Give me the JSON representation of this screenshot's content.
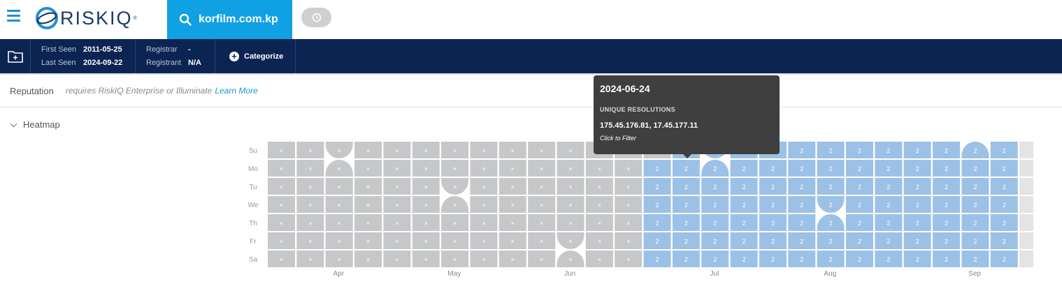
{
  "header": {
    "logo_text": "RISKIQ",
    "logo_reg": "®",
    "search_query": "korfilm.com.kp",
    "icons": [
      "menu-icon",
      "search-icon",
      "history-icon"
    ]
  },
  "infobar": {
    "first_seen_label": "First Seen",
    "first_seen_value": "2011-05-25",
    "last_seen_label": "Last Seen",
    "last_seen_value": "2024-09-22",
    "registrar_label": "Registrar",
    "registrar_value": "-",
    "registrant_label": "Registrant",
    "registrant_value": "N/A",
    "categorize_label": "Categorize"
  },
  "reputation": {
    "title": "Reputation",
    "note": "requires RiskIQ Enterprise or Illuminate",
    "link": "Learn More"
  },
  "heatmap": {
    "title": "Heatmap",
    "day_labels": [
      "Su",
      "Mo",
      "Tu",
      "We",
      "Th",
      "Fr",
      "Sa"
    ],
    "month_labels": [
      {
        "label": "Apr",
        "week": 2.5
      },
      {
        "label": "May",
        "week": 6.5
      },
      {
        "label": "Jun",
        "week": 10.5
      },
      {
        "label": "Jul",
        "week": 15.5
      },
      {
        "label": "Aug",
        "week": 19.5
      },
      {
        "label": "Sep",
        "week": 24.5
      }
    ],
    "weeks": 27,
    "active_from": {
      "week": 14,
      "day": 0
    },
    "active_value": "2",
    "month_starts": [
      {
        "week": 2,
        "day": 1
      },
      {
        "week": 6,
        "day": 3
      },
      {
        "week": 10,
        "day": 6
      },
      {
        "week": 15,
        "day": 1
      },
      {
        "week": 19,
        "day": 4
      },
      {
        "week": 24,
        "day": 0
      }
    ],
    "empty_symbol": "×",
    "colors": {
      "empty": "#c6c7c9",
      "active": "#9cc1e6",
      "last_column": "#e4e4e4"
    }
  },
  "tooltip": {
    "date": "2024-06-24",
    "header": "UNIQUE RESOLUTIONS",
    "ips": "175.45.176.81, 17.45.177.11",
    "hint": "Click to Filter"
  }
}
